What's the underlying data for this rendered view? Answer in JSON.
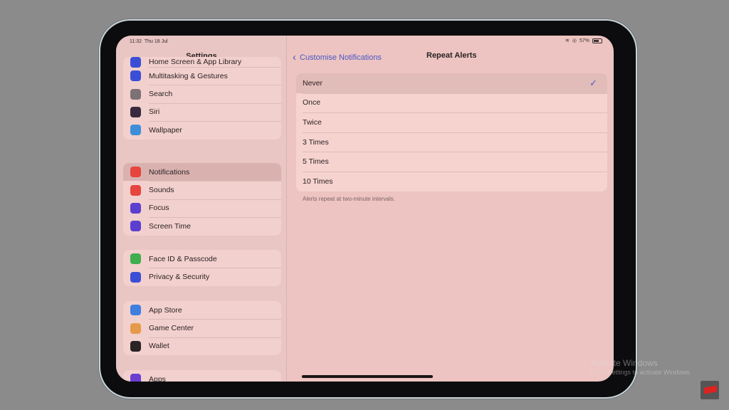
{
  "status_bar": {
    "time": "11:32",
    "date": "Thu 18 Jul",
    "battery": "57%",
    "battery_level": 57
  },
  "sidebar": {
    "title": "Settings",
    "groups": [
      [
        {
          "label": "Home Screen & App Library",
          "icon": "home-screen-icon",
          "color": "#3b4fd6"
        },
        {
          "label": "Multitasking & Gestures",
          "icon": "multitasking-icon",
          "color": "#3b4fd6"
        },
        {
          "label": "Search",
          "icon": "search-icon",
          "color": "#7d7273"
        },
        {
          "label": "Siri",
          "icon": "siri-icon",
          "color": "#3a2a40"
        },
        {
          "label": "Wallpaper",
          "icon": "wallpaper-icon",
          "color": "#3f8fd8"
        }
      ],
      [
        {
          "label": "Notifications",
          "icon": "notifications-icon",
          "color": "#e5443f",
          "selected": true
        },
        {
          "label": "Sounds",
          "icon": "sounds-icon",
          "color": "#e5443f"
        },
        {
          "label": "Focus",
          "icon": "focus-icon",
          "color": "#5b3fd0"
        },
        {
          "label": "Screen Time",
          "icon": "hourglass-icon",
          "color": "#5b3fd0"
        }
      ],
      [
        {
          "label": "Face ID & Passcode",
          "icon": "face-id-icon",
          "color": "#3fae4f"
        },
        {
          "label": "Privacy & Security",
          "icon": "hand-icon",
          "color": "#3b4fd6"
        }
      ],
      [
        {
          "label": "App Store",
          "icon": "app-store-icon",
          "color": "#3f7fe0"
        },
        {
          "label": "Game Center",
          "icon": "game-center-icon",
          "color": "#e59a4a"
        },
        {
          "label": "Wallet",
          "icon": "wallet-icon",
          "color": "#2a2223"
        }
      ],
      [
        {
          "label": "Apps",
          "icon": "apps-icon",
          "color": "#6a3fd0"
        }
      ]
    ]
  },
  "detail": {
    "back_label": "Customise Notifications",
    "title": "Repeat Alerts",
    "options": [
      {
        "label": "Never",
        "selected": true
      },
      {
        "label": "Once"
      },
      {
        "label": "Twice"
      },
      {
        "label": "3 Times"
      },
      {
        "label": "5 Times"
      },
      {
        "label": "10 Times"
      }
    ],
    "footer": "Alerts repeat at two-minute intervals."
  },
  "watermark": {
    "title": "Activate Windows",
    "subtitle": "Go to Settings to activate Windows."
  },
  "accent_color": "#4a57c7"
}
